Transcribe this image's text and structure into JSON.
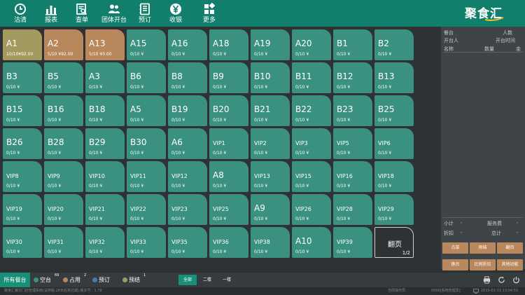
{
  "toolbar": {
    "items": [
      {
        "label": "沽清",
        "icon": "clock-icon"
      },
      {
        "label": "报表",
        "icon": "bar-chart-icon"
      },
      {
        "label": "查单",
        "icon": "search-document-icon"
      },
      {
        "label": "团体开台",
        "icon": "group-icon"
      },
      {
        "label": "预订",
        "icon": "notebook-icon"
      },
      {
        "label": "收银",
        "icon": "yen-icon"
      },
      {
        "label": "更多",
        "icon": "grid-icon"
      }
    ],
    "logo": "聚食汇"
  },
  "tables": [
    {
      "name": "A1",
      "status": "10/10¥92.00",
      "state": "busy-a"
    },
    {
      "name": "A2",
      "status": "5/10 ¥92.00",
      "state": "busy-b"
    },
    {
      "name": "A13",
      "status": "5/10 ¥0.00",
      "state": "busy-b"
    },
    {
      "name": "A15",
      "status": "0/10 ¥",
      "state": "free"
    },
    {
      "name": "A16",
      "status": "0/10 ¥",
      "state": "free"
    },
    {
      "name": "A18",
      "status": "0/10 ¥",
      "state": "free"
    },
    {
      "name": "A19",
      "status": "0/10 ¥",
      "state": "free"
    },
    {
      "name": "A20",
      "status": "0/10 ¥",
      "state": "free"
    },
    {
      "name": "B1",
      "status": "0/10 ¥",
      "state": "free"
    },
    {
      "name": "B2",
      "status": "0/10 ¥",
      "state": "free"
    },
    {
      "name": "B3",
      "status": "0/10 ¥",
      "state": "free"
    },
    {
      "name": "B5",
      "status": "0/10 ¥",
      "state": "free"
    },
    {
      "name": "A3",
      "status": "0/10 ¥",
      "state": "free"
    },
    {
      "name": "B6",
      "status": "0/10 ¥",
      "state": "free"
    },
    {
      "name": "B8",
      "status": "0/10 ¥",
      "state": "free"
    },
    {
      "name": "B9",
      "status": "0/10 ¥",
      "state": "free"
    },
    {
      "name": "B10",
      "status": "0/10 ¥",
      "state": "free"
    },
    {
      "name": "B11",
      "status": "0/10 ¥",
      "state": "free"
    },
    {
      "name": "B12",
      "status": "0/10 ¥",
      "state": "free"
    },
    {
      "name": "B13",
      "status": "0/10 ¥",
      "state": "free"
    },
    {
      "name": "B15",
      "status": "0/10 ¥",
      "state": "free"
    },
    {
      "name": "B16",
      "status": "0/10 ¥",
      "state": "free"
    },
    {
      "name": "B18",
      "status": "0/10 ¥",
      "state": "free"
    },
    {
      "name": "A5",
      "status": "0/10 ¥",
      "state": "free"
    },
    {
      "name": "B19",
      "status": "0/10 ¥",
      "state": "free"
    },
    {
      "name": "B20",
      "status": "0/10 ¥",
      "state": "free"
    },
    {
      "name": "B21",
      "status": "0/10 ¥",
      "state": "free"
    },
    {
      "name": "B22",
      "status": "0/10 ¥",
      "state": "free"
    },
    {
      "name": "B23",
      "status": "0/10 ¥",
      "state": "free"
    },
    {
      "name": "B25",
      "status": "0/10 ¥",
      "state": "free"
    },
    {
      "name": "B26",
      "status": "0/10 ¥",
      "state": "free"
    },
    {
      "name": "B28",
      "status": "0/10 ¥",
      "state": "free"
    },
    {
      "name": "B29",
      "status": "0/10 ¥",
      "state": "free"
    },
    {
      "name": "B30",
      "status": "0/10 ¥",
      "state": "free"
    },
    {
      "name": "A6",
      "status": "0/10 ¥",
      "state": "free"
    },
    {
      "name": "VIP1",
      "status": "0/10 ¥",
      "state": "free"
    },
    {
      "name": "VIP2",
      "status": "0/10 ¥",
      "state": "free"
    },
    {
      "name": "VIP3",
      "status": "0/10 ¥",
      "state": "free"
    },
    {
      "name": "VIP5",
      "status": "0/10 ¥",
      "state": "free"
    },
    {
      "name": "VIP6",
      "status": "0/10 ¥",
      "state": "free"
    },
    {
      "name": "VIP8",
      "status": "0/10 ¥",
      "state": "free"
    },
    {
      "name": "VIP9",
      "status": "0/10 ¥",
      "state": "free"
    },
    {
      "name": "VIP10",
      "status": "0/10 ¥",
      "state": "free"
    },
    {
      "name": "VIP11",
      "status": "0/10 ¥",
      "state": "free"
    },
    {
      "name": "VIP12",
      "status": "0/10 ¥",
      "state": "free"
    },
    {
      "name": "A8",
      "status": "0/10 ¥",
      "state": "free"
    },
    {
      "name": "VIP13",
      "status": "0/10 ¥",
      "state": "free"
    },
    {
      "name": "VIP15",
      "status": "0/10 ¥",
      "state": "free"
    },
    {
      "name": "VIP16",
      "status": "0/10 ¥",
      "state": "free"
    },
    {
      "name": "VIP18",
      "status": "0/10 ¥",
      "state": "free"
    },
    {
      "name": "VIP19",
      "status": "0/10 ¥",
      "state": "free"
    },
    {
      "name": "VIP20",
      "status": "0/10 ¥",
      "state": "free"
    },
    {
      "name": "VIP21",
      "status": "0/10 ¥",
      "state": "free"
    },
    {
      "name": "VIP22",
      "status": "0/10 ¥",
      "state": "free"
    },
    {
      "name": "VIP23",
      "status": "0/10 ¥",
      "state": "free"
    },
    {
      "name": "VIP25",
      "status": "0/10 ¥",
      "state": "free"
    },
    {
      "name": "A9",
      "status": "0/10 ¥",
      "state": "free"
    },
    {
      "name": "VIP26",
      "status": "0/10 ¥",
      "state": "free"
    },
    {
      "name": "VIP28",
      "status": "0/10 ¥",
      "state": "free"
    },
    {
      "name": "VIP29",
      "status": "0/10 ¥",
      "state": "free"
    },
    {
      "name": "VIP30",
      "status": "0/10 ¥",
      "state": "free"
    },
    {
      "name": "VIP31",
      "status": "0/10 ¥",
      "state": "free"
    },
    {
      "name": "VIP32",
      "status": "0/10 ¥",
      "state": "free"
    },
    {
      "name": "VIP33",
      "status": "0/10 ¥",
      "state": "free"
    },
    {
      "name": "VIP35",
      "status": "0/10 ¥",
      "state": "free"
    },
    {
      "name": "VIP36",
      "status": "0/10 ¥",
      "state": "free"
    },
    {
      "name": "VIP38",
      "status": "0/10 ¥",
      "state": "free"
    },
    {
      "name": "A10",
      "status": "0/10 ¥",
      "state": "free"
    },
    {
      "name": "VIP39",
      "status": "0/10 ¥",
      "state": "free"
    }
  ],
  "pager": {
    "label": "翻页",
    "page": "1/2"
  },
  "panel": {
    "table_label": "餐台",
    "people_label": "人数",
    "opener_label": "开台人",
    "open_time_label": "开台时间",
    "col_name": "名称",
    "col_qty": "数量",
    "col_amount": "金",
    "subtotal_label": "小计",
    "service_label": "服务费",
    "discount_label": "折扣",
    "total_label": "总计",
    "dash": "-",
    "buttons": [
      "点菜",
      "预结",
      "翻页",
      "换台",
      "比例折扣",
      "其他功能"
    ]
  },
  "bottom": {
    "all_tables": "所有餐台",
    "legend": [
      {
        "label": "空台",
        "count": "69",
        "color": "#3a9180"
      },
      {
        "label": "占用",
        "count": "2",
        "color": "#b9875c"
      },
      {
        "label": "预订",
        "count": "",
        "color": "#4a78b8"
      },
      {
        "label": "预结",
        "count": "1",
        "color": "#a39a5f"
      }
    ],
    "floors": [
      "全部",
      "二楼",
      "一楼"
    ]
  },
  "status": {
    "left": "聚食汇餐饮门店管理系统(试用版:28天后将过期) 版本号：1.78",
    "operator": "当前操作员:",
    "operator_value": "0000[系统管理员]",
    "datetime": "2015-01-11 13:04:53"
  },
  "colors": {
    "brand": "#127f6c",
    "free": "#3a9180",
    "occupied": "#b9875c",
    "prebill": "#a39a5f"
  }
}
